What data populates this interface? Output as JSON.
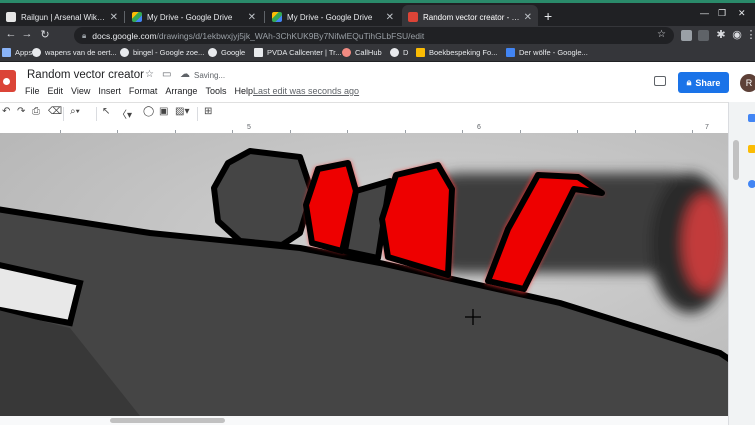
{
  "browser": {
    "tabs": [
      {
        "title": "Railgun | Arsenal Wiki | Fandom",
        "favicon_color": "#e5e5e5",
        "active": false
      },
      {
        "title": "My Drive - Google Drive",
        "favicon_color": "#34a853",
        "active": false
      },
      {
        "title": "My Drive - Google Drive",
        "favicon_color": "#34a853",
        "active": false
      },
      {
        "title": "Random vector creator - Google",
        "favicon_color": "#db4437",
        "active": true
      }
    ],
    "new_tab": "+",
    "url_host": "docs.google.com",
    "url_path": "/drawings/d/1ekbwxjyj5jk_WAh-3ChKUK9By7NifwlEQuTihGLbFSU/edit",
    "extensions": [
      {
        "name": "ext-gray",
        "color": "#9aa0a6"
      },
      {
        "name": "ext-c",
        "color": "#5f6368"
      },
      {
        "name": "puzzle",
        "color": "#dadce0"
      },
      {
        "name": "menu",
        "color": "#dadce0"
      }
    ]
  },
  "bookmarks": [
    {
      "label": "Apps",
      "color": "#8ab4f8"
    },
    {
      "label": "wapens van de oert...",
      "color": "#e8eaed"
    },
    {
      "label": "bingel - Google zoe...",
      "color": "#e8eaed"
    },
    {
      "label": "Google",
      "color": "#e8eaed"
    },
    {
      "label": "PVDA Callcenter | Tr...",
      "color": "#e8eaed"
    },
    {
      "label": "CallHub",
      "color": "#f28b82"
    },
    {
      "label": "D",
      "color": "#e8eaed"
    },
    {
      "label": "Boekbespeking Fo...",
      "color": "#fbbc04"
    },
    {
      "label": "Der wölfe - Google...",
      "color": "#4285f4"
    }
  ],
  "docs": {
    "title": "Random vector creator",
    "saving": "Saving...",
    "menu": [
      "File",
      "Edit",
      "View",
      "Insert",
      "Format",
      "Arrange",
      "Tools",
      "Help"
    ],
    "last_edit": "Last edit was seconds ago",
    "share": "Share",
    "avatar_letter": "R"
  },
  "ruler": [
    "5",
    "6",
    "7"
  ],
  "colors": {
    "accent": "#1a73e8",
    "shape_red": "#ee0000",
    "shape_gray": "#444444",
    "outline": "#000000"
  }
}
